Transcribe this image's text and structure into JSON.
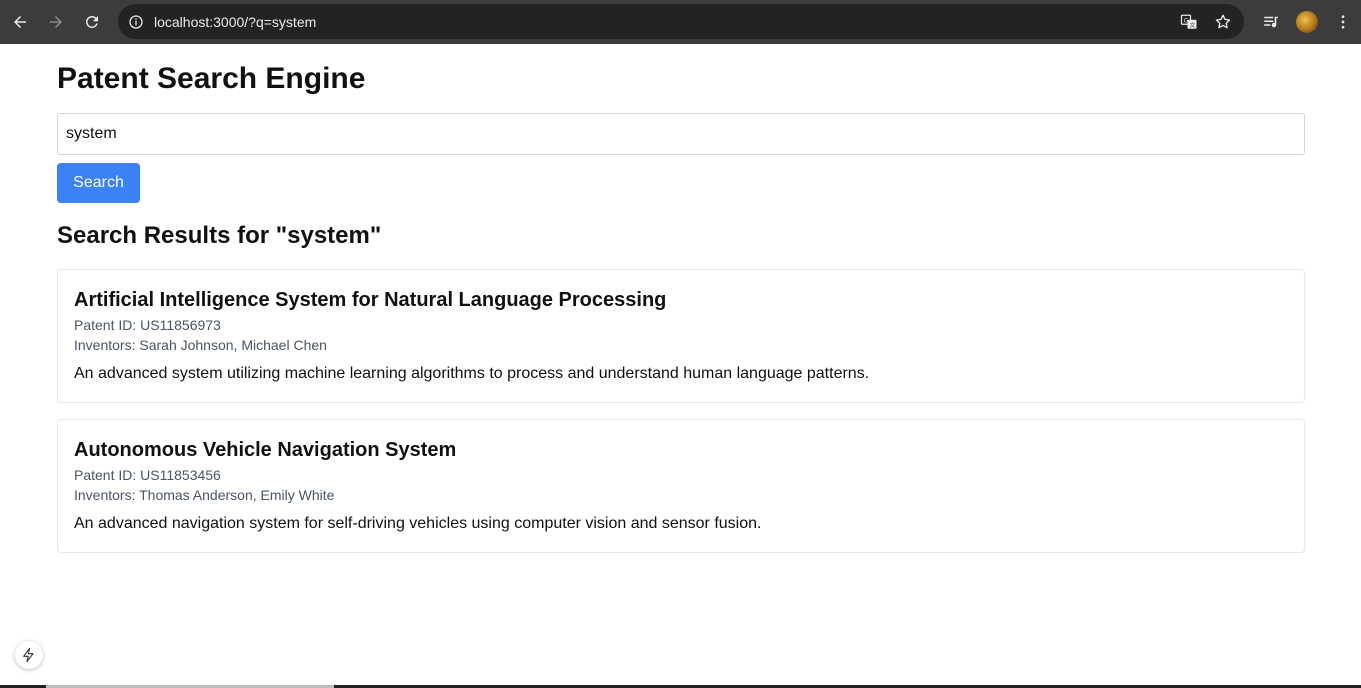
{
  "browser": {
    "url": "localhost:3000/?q=system",
    "icons": [
      "back-arrow-icon",
      "forward-arrow-icon",
      "reload-icon",
      "site-info-icon",
      "translate-icon",
      "bookmark-star-icon",
      "media-playlist-icon",
      "profile-avatar-icon",
      "kebab-menu-icon"
    ]
  },
  "page": {
    "title": "Patent Search Engine",
    "search": {
      "value": "system",
      "button_label": "Search"
    },
    "results_heading": "Search Results for \"system\"",
    "results": [
      {
        "title": "Artificial Intelligence System for Natural Language Processing",
        "patent_id": "Patent ID: US11856973",
        "inventors": "Inventors: Sarah Johnson, Michael Chen",
        "description": "An advanced system utilizing machine learning algorithms to process and understand human language patterns."
      },
      {
        "title": "Autonomous Vehicle Navigation System",
        "patent_id": "Patent ID: US11853456",
        "inventors": "Inventors: Thomas Anderson, Emily White",
        "description": "An advanced navigation system for self-driving vehicles using computer vision and sensor fusion."
      }
    ]
  },
  "colors": {
    "chrome_bg": "#3c3c3c",
    "omnibox_bg": "#232323",
    "button_blue": "#3b82f6",
    "meta_gray": "#4b5563",
    "card_border": "#e5e7eb"
  }
}
